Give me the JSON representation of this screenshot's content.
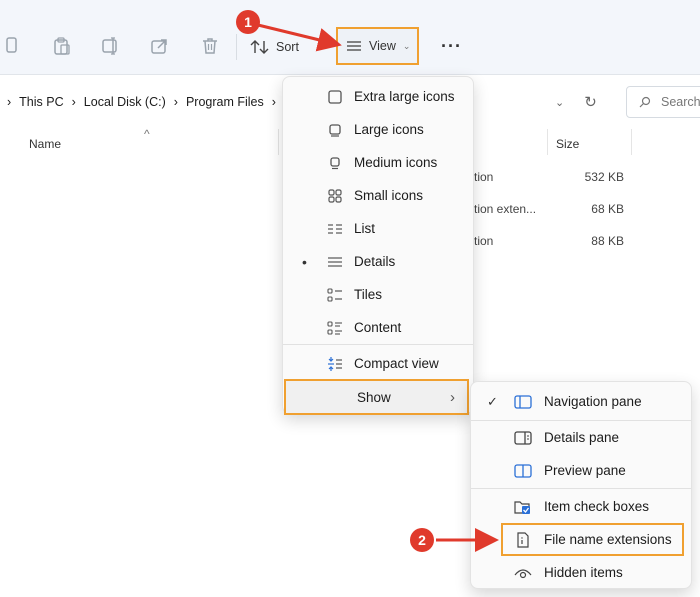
{
  "toolbar": {
    "sort_label": "Sort",
    "view_label": "View",
    "more_label": "···",
    "icons": [
      "copy-icon",
      "paste-icon",
      "rename-icon",
      "share-icon",
      "delete-icon"
    ]
  },
  "address": {
    "crumbs": [
      "This PC",
      "Local Disk (C:)",
      "Program Files"
    ],
    "search_placeholder": "Search"
  },
  "columns": {
    "name": "Name",
    "size": "Size"
  },
  "files": [
    {
      "type_partial": "tion",
      "size": "532 KB"
    },
    {
      "type_partial": "tion exten...",
      "size": "68 KB"
    },
    {
      "type_partial": "tion",
      "size": "88 KB"
    }
  ],
  "view_menu": {
    "items": [
      {
        "label": "Extra large icons",
        "icon": "extra-large-icons-icon"
      },
      {
        "label": "Large icons",
        "icon": "large-icons-icon"
      },
      {
        "label": "Medium icons",
        "icon": "medium-icons-icon"
      },
      {
        "label": "Small icons",
        "icon": "small-icons-icon"
      },
      {
        "label": "List",
        "icon": "list-icon"
      },
      {
        "label": "Details",
        "icon": "details-icon",
        "selected": true
      },
      {
        "label": "Tiles",
        "icon": "tiles-icon"
      },
      {
        "label": "Content",
        "icon": "content-icon"
      }
    ],
    "compact": "Compact view",
    "show": "Show"
  },
  "show_menu": {
    "items": [
      {
        "label": "Navigation pane",
        "checked": true
      },
      {
        "label": "Details pane"
      },
      {
        "label": "Preview pane"
      },
      {
        "label": "Item check boxes"
      },
      {
        "label": "File name extensions"
      },
      {
        "label": "Hidden items"
      }
    ]
  },
  "annotations": {
    "badge1": "1",
    "badge2": "2",
    "color": "#e03a2c",
    "highlight": "#f0a030"
  }
}
